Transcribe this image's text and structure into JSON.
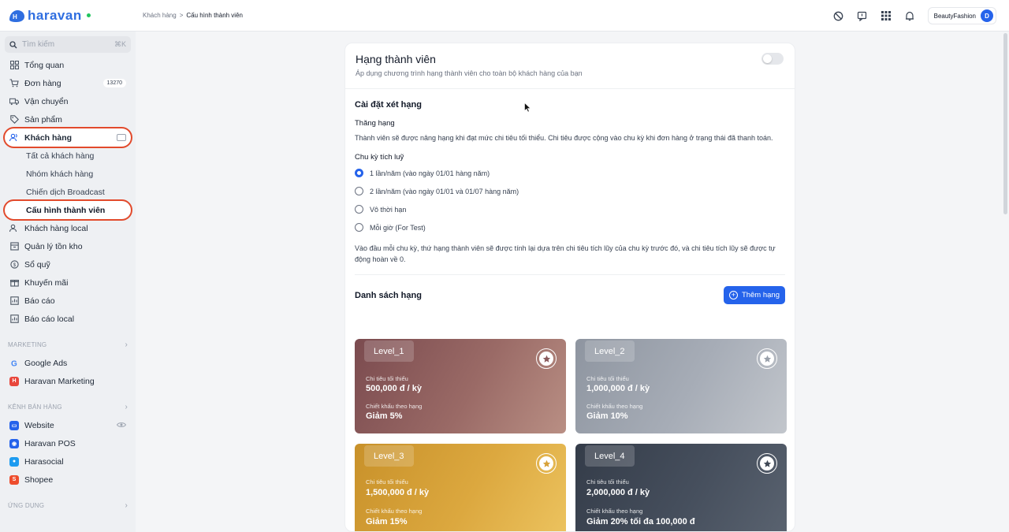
{
  "app": {
    "logo_text": "haravan"
  },
  "breadcrumb": {
    "parent": "Khách hàng",
    "separator": ">",
    "current": "Cấu hình thành viên"
  },
  "topbar": {
    "store": "BeautyFashion",
    "avatar": "D"
  },
  "search": {
    "placeholder": "Tìm kiếm",
    "shortcut": "⌘K"
  },
  "sidebar": {
    "items": [
      {
        "label": "Tổng quan",
        "icon": "dashboard-icon"
      },
      {
        "label": "Đơn hàng",
        "icon": "cart-icon",
        "badge": "13270"
      },
      {
        "label": "Vận chuyển",
        "icon": "truck-icon"
      },
      {
        "label": "Sản phẩm",
        "icon": "tag-icon"
      },
      {
        "label": "Khách hàng",
        "icon": "users-icon"
      }
    ],
    "customer_sub": [
      {
        "label": "Tất cả khách hàng"
      },
      {
        "label": "Nhóm khách hàng"
      },
      {
        "label": "Chiến dịch Broadcast"
      },
      {
        "label": "Cấu hình thành viên"
      }
    ],
    "items2": [
      {
        "label": "Khách hàng local",
        "icon": "users-icon"
      },
      {
        "label": "Quản lý tồn kho",
        "icon": "box-icon"
      },
      {
        "label": "Sổ quỹ",
        "icon": "coin-icon"
      },
      {
        "label": "Khuyến mãi",
        "icon": "gift-icon"
      },
      {
        "label": "Báo cáo",
        "icon": "report-icon"
      },
      {
        "label": "Báo cáo local",
        "icon": "report-icon"
      }
    ],
    "marketing_title": "MARKETING",
    "marketing": [
      {
        "label": "Google Ads"
      },
      {
        "label": "Haravan Marketing"
      }
    ],
    "sales_title": "KÊNH BÁN HÀNG",
    "sales": [
      {
        "label": "Website"
      },
      {
        "label": "Haravan POS"
      },
      {
        "label": "Harasocial"
      },
      {
        "label": "Shopee"
      }
    ],
    "apps_title": "ỨNG DỤNG"
  },
  "card": {
    "title": "Hạng thành viên",
    "subtitle": "Áp dụng chương trình hạng thành viên cho toàn bộ khách hàng của bạn",
    "settings_title": "Cài đặt xét hạng",
    "upgrade_label": "Thăng hạng",
    "upgrade_desc": "Thành viên sẽ được nâng hạng khi đạt mức chi tiêu tối thiểu. Chi tiêu được cộng vào chu kỳ khi đơn hàng ở trạng thái đã thanh toán.",
    "cycle_label": "Chu kỳ tích luỹ",
    "cycle_options": [
      {
        "label": "1 lần/năm (vào ngày 01/01 hàng năm)"
      },
      {
        "label": "2 lần/năm (vào ngày 01/01 và 01/07 hàng năm)"
      },
      {
        "label": "Vô thời hạn"
      },
      {
        "label": "Mỗi giờ (For Test)"
      }
    ],
    "cycle_note": "Vào đầu mỗi chu kỳ, thứ hạng thành viên sẽ được tính lại dựa trên chi tiêu tích lũy của chu kỳ trước đó, và chi tiêu tích lũy sẽ được tự động hoàn về 0.",
    "list_title": "Danh sách hạng",
    "add_button": "Thêm hạng"
  },
  "levels": [
    {
      "name": "Level_1",
      "min_label": "Chi tiêu tối thiểu",
      "min_value": "500,000 đ / kỳ",
      "discount_label": "Chiết khấu theo hạng",
      "discount_value": "Giảm 5%"
    },
    {
      "name": "Level_2",
      "min_label": "Chi tiêu tối thiểu",
      "min_value": "1,000,000 đ / kỳ",
      "discount_label": "Chiết khấu theo hạng",
      "discount_value": "Giảm 10%"
    },
    {
      "name": "Level_3",
      "min_label": "Chi tiêu tối thiểu",
      "min_value": "1,500,000 đ / kỳ",
      "discount_label": "Chiết khấu theo hạng",
      "discount_value": "Giảm 15%"
    },
    {
      "name": "Level_4",
      "min_label": "Chi tiêu tối thiểu",
      "min_value": "2,000,000 đ / kỳ",
      "discount_label": "Chiết khấu theo hạng",
      "discount_value": "Giảm 20% tối đa 100,000 đ"
    }
  ],
  "colors": {
    "accent": "#2563eb",
    "highlight": "#e24a2c",
    "level_1": "#8a5a5c",
    "level_2": "#9aa1ab",
    "level_3": "#d8a23a",
    "level_4": "#3f4855"
  }
}
